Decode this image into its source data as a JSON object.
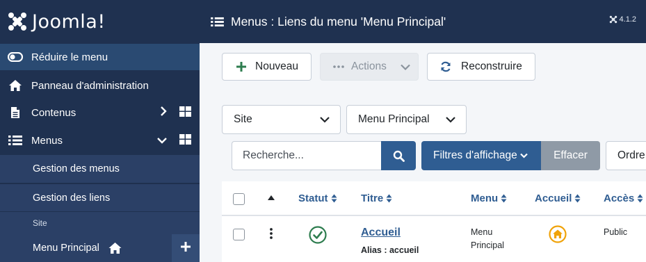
{
  "sidebar": {
    "brand": "Joomla!",
    "collapse_label": "Réduire le menu",
    "items": [
      {
        "label": "Panneau d'administration",
        "icon": "home-icon"
      },
      {
        "label": "Contenus",
        "icon": "file-icon"
      },
      {
        "label": "Menus",
        "icon": "list-icon"
      }
    ],
    "submenu": {
      "manage_menus": "Gestion des menus",
      "manage_links": "Gestion des liens",
      "section_label": "Site",
      "current_menu": "Menu Principal"
    }
  },
  "header": {
    "title": "Menus : Liens du menu 'Menu Principal'",
    "version": "4.1.2"
  },
  "toolbar": {
    "new_label": "Nouveau",
    "actions_label": "Actions",
    "rebuild_label": "Reconstruire"
  },
  "filters": {
    "client_selected": "Site",
    "menu_selected": "Menu Principal",
    "search_placeholder": "Recherche...",
    "filter_options_label": "Filtres d'affichage",
    "clear_label": "Effacer",
    "order_label": "Ordre"
  },
  "table": {
    "columns": [
      "Statut",
      "Titre",
      "Menu",
      "Accueil",
      "Accès"
    ],
    "rows": [
      {
        "title": "Accueil",
        "alias": "Alias : accueil",
        "menu": [
          "Menu",
          "Principal"
        ],
        "access": "Public",
        "status": "published",
        "home": true
      }
    ]
  },
  "colors": {
    "sidebar_bg": "#1f3150",
    "active_bg": "#2a4a72",
    "primary": "#2f5d92",
    "success": "#2e7d4f",
    "home_orange": "#f0a30a"
  }
}
